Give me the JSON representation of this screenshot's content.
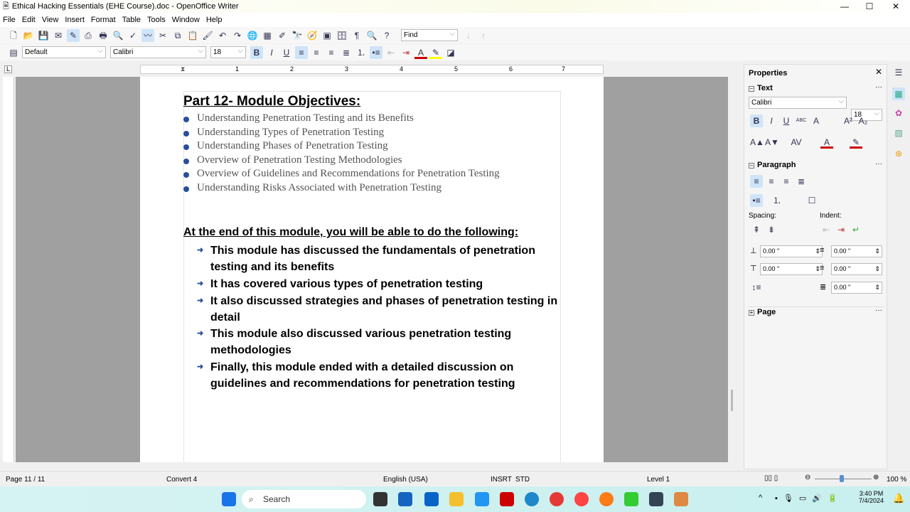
{
  "window": {
    "title": "Ethical Hacking Essentials (EHE Course).doc - OpenOffice Writer",
    "minimize": "—",
    "maximize": "☐",
    "close": "✕"
  },
  "menu": [
    "File",
    "Edit",
    "View",
    "Insert",
    "Format",
    "Table",
    "Tools",
    "Window",
    "Help"
  ],
  "toolbar_standard": {
    "icons": [
      "new-icon",
      "open-icon",
      "save-icon",
      "email-icon",
      "edit-mode-icon",
      "export-pdf-icon",
      "print-icon",
      "print-preview-icon",
      "spellcheck-icon",
      "autospellcheck-icon",
      "cut-icon",
      "copy-icon",
      "paste-icon",
      "clone-format-icon",
      "undo-icon",
      "redo-icon",
      "hyperlink-icon",
      "table-icon",
      "draw-icon",
      "find-replace-icon",
      "navigator-icon",
      "gallery-icon",
      "data-sources-icon",
      "formatting-marks-icon",
      "zoom-icon",
      "help-icon"
    ],
    "find_placeholder": "Find"
  },
  "toolbar_formatting": {
    "style": "Default",
    "font": "Calibri",
    "size": "18",
    "bold": true,
    "italic": false,
    "underline": false,
    "align": "left"
  },
  "ruler": {
    "ticks": [
      "1",
      "2",
      "3",
      "4",
      "5",
      "6",
      "7"
    ]
  },
  "document": {
    "heading": "Part 12- Module Objectives:",
    "objectives": [
      "Understanding Penetration Testing and its Benefits",
      "Understanding Types of Penetration Testing",
      "Understanding Phases of Penetration Testing",
      "Overview of Penetration Testing Methodologies",
      "Overview of Guidelines and Recommendations for Penetration Testing",
      "Understanding Risks Associated with Penetration Testing"
    ],
    "subheading": "At the end of this module, you will be able to do the following:",
    "outcomes": [
      "This module has discussed the fundamentals of penetration testing and its benefits",
      "It has covered various types of penetration testing",
      "It also discussed strategies and phases of penetration testing in detail",
      "This module also discussed various penetration testing methodologies",
      "Finally, this module ended with a detailed discussion on guidelines and recommendations for penetration testing"
    ]
  },
  "sidebar": {
    "title": "Properties",
    "text_section": "Text",
    "font": "Calibri",
    "size": "18",
    "paragraph_section": "Paragraph",
    "spacing_label": "Spacing:",
    "indent_label": "Indent:",
    "spacing_above": "0.00 \"",
    "spacing_below": "0.00 \"",
    "indent_before": "0.00 \"",
    "indent_after": "0.00 \"",
    "first_line": "0.00 \"",
    "page_section": "Page"
  },
  "status": {
    "page": "Page 11 / 11",
    "style": "Convert 4",
    "language": "English (USA)",
    "insert": "INSRT",
    "selection": "STD",
    "level": "Level 1",
    "zoom": "100 %",
    "zoom_percent": 100
  },
  "taskbar": {
    "search": "Search",
    "time": "3:40 PM",
    "date": "7/4/2024"
  }
}
